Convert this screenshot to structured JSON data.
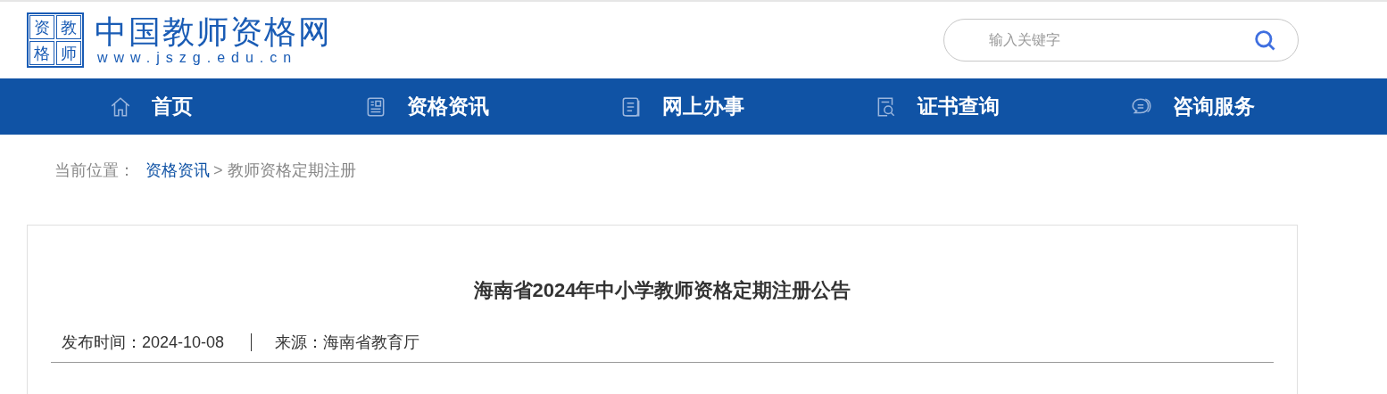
{
  "logo": {
    "seal_chars": [
      "资",
      "教",
      "格",
      "师"
    ],
    "title": "中国教师资格网",
    "url": "www.jszg.edu.cn"
  },
  "search": {
    "placeholder": "输入关键字"
  },
  "nav": [
    {
      "label": "首页",
      "kind": "home"
    },
    {
      "label": "资格资讯",
      "kind": "news"
    },
    {
      "label": "网上办事",
      "kind": "doc"
    },
    {
      "label": "证书查询",
      "kind": "query"
    },
    {
      "label": "咨询服务",
      "kind": "chat"
    }
  ],
  "breadcrumb": {
    "prefix": "当前位置：",
    "items": [
      {
        "label": "资格资讯",
        "kind": "link"
      },
      {
        "label": "> 教师资格定期注册",
        "kind": "text"
      }
    ]
  },
  "article": {
    "title": "海南省2024年中小学教师资格定期注册公告",
    "published": "发布时间：2024-10-08",
    "source": "来源：海南省教育厅"
  }
}
